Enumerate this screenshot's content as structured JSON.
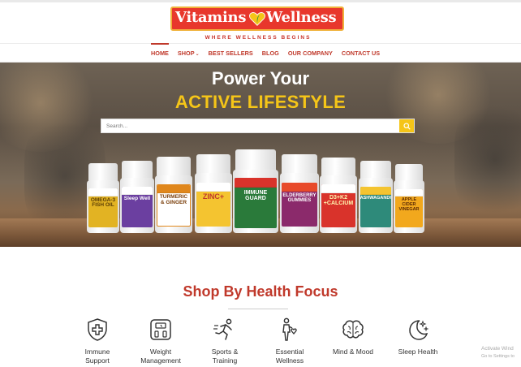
{
  "brand": {
    "name_left": "Vitamins",
    "name_right": "Wellness",
    "tagline": "WHERE WELLNESS BEGINS"
  },
  "nav": {
    "items": [
      {
        "label": "HOME",
        "active": true
      },
      {
        "label": "SHOP",
        "has_dropdown": true
      },
      {
        "label": "BEST SELLERS"
      },
      {
        "label": "BLOG"
      },
      {
        "label": "OUR COMPANY"
      },
      {
        "label": "CONTACT US"
      }
    ]
  },
  "hero": {
    "line1": "Power Your",
    "line2": "ACTIVE LIFESTYLE",
    "search_placeholder": "Search..."
  },
  "products": [
    {
      "name": "OMEGA-3 FISH OIL",
      "color": "#e2b323"
    },
    {
      "name": "Sleep Well",
      "color": "#6b3fa0"
    },
    {
      "name": "TURMERIC & GINGER",
      "color": "#e0871c"
    },
    {
      "name": "ZINC+",
      "color": "#e84a2a"
    },
    {
      "name": "IMMUNE GUARD",
      "color": "#2a7a3a"
    },
    {
      "name": "ELDERBERRY GUMMIES",
      "color": "#8b2a6b"
    },
    {
      "name": "D3+K2 +CALCIUM",
      "color": "#d9332b"
    },
    {
      "name": "ASHWAGANDHA",
      "color": "#2e8a7a"
    },
    {
      "name": "APPLE CIDER VINEGAR",
      "color": "#f2a81d"
    }
  ],
  "health_focus": {
    "title": "Shop By Health Focus",
    "items": [
      {
        "label_line1": "Immune",
        "label_line2": "Support",
        "icon": "shield-cross-icon"
      },
      {
        "label_line1": "Weight",
        "label_line2": "Management",
        "icon": "scale-icon"
      },
      {
        "label_line1": "Sports &",
        "label_line2": "Training",
        "icon": "runner-icon"
      },
      {
        "label_line1": "Essential",
        "label_line2": "Wellness",
        "icon": "person-heart-icon"
      },
      {
        "label_line1": "Mind & Mood",
        "label_line2": "",
        "icon": "brain-icon"
      },
      {
        "label_line1": "Sleep Health",
        "label_line2": "",
        "icon": "moon-stars-icon"
      }
    ]
  },
  "watermark": {
    "line1": "Activate Wind",
    "line2": "Go to Settings to"
  },
  "colors": {
    "brand_red": "#c0392b",
    "accent_yellow": "#f5c518"
  }
}
